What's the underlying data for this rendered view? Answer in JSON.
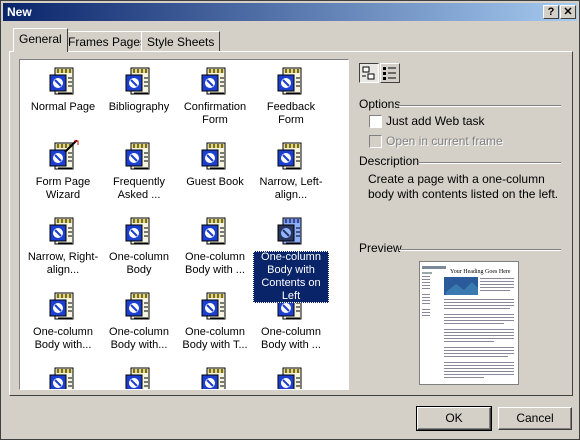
{
  "window": {
    "title": "New"
  },
  "title_buttons": {
    "help": "?",
    "close": "✕"
  },
  "tabs": [
    {
      "label": "General",
      "active": true
    },
    {
      "label": "Frames Pages",
      "active": false
    },
    {
      "label": "Style Sheets",
      "active": false
    }
  ],
  "templates": [
    {
      "label": "Normal Page",
      "icon": "page-template-icon"
    },
    {
      "label": "Bibliography",
      "icon": "page-template-icon"
    },
    {
      "label": "Confirmation Form",
      "icon": "page-template-icon"
    },
    {
      "label": "Feedback Form",
      "icon": "page-template-icon"
    },
    {
      "label": "Form Page Wizard",
      "icon": "wizard-template-icon"
    },
    {
      "label": "Frequently Asked ...",
      "icon": "page-template-icon"
    },
    {
      "label": "Guest Book",
      "icon": "page-template-icon"
    },
    {
      "label": "Narrow, Left-align...",
      "icon": "page-template-icon"
    },
    {
      "label": "Narrow, Right-align...",
      "icon": "page-template-icon"
    },
    {
      "label": "One-column Body",
      "icon": "page-template-icon"
    },
    {
      "label": "One-column Body with ...",
      "icon": "page-template-icon"
    },
    {
      "label": "One-column Body with Contents on Left",
      "icon": "page-template-icon",
      "selected": true
    },
    {
      "label": "One-column Body with...",
      "icon": "page-template-icon"
    },
    {
      "label": "One-column Body with...",
      "icon": "page-template-icon"
    },
    {
      "label": "One-column Body with T...",
      "icon": "page-template-icon"
    },
    {
      "label": "One-column Body with ...",
      "icon": "page-template-icon"
    },
    {
      "label": "",
      "icon": "page-template-icon"
    },
    {
      "label": "",
      "icon": "page-template-icon"
    },
    {
      "label": "",
      "icon": "page-template-icon"
    },
    {
      "label": "",
      "icon": "page-template-icon"
    }
  ],
  "view_buttons": {
    "large_icons": "large-icons-view-icon",
    "list": "list-view-icon"
  },
  "options": {
    "heading": "Options",
    "just_add_web_task": {
      "label": "Just add Web task",
      "checked": false,
      "enabled": true
    },
    "open_in_current_frame": {
      "label": "Open in current frame",
      "checked": false,
      "enabled": false
    }
  },
  "description": {
    "heading": "Description",
    "text": "Create a page with a one-column body with contents listed on the left."
  },
  "preview": {
    "heading": "Preview",
    "page_heading": "Your Heading Goes Here"
  },
  "buttons": {
    "ok": "OK",
    "cancel": "Cancel"
  },
  "colors": {
    "face": "#d4d0c8",
    "selection": "#0a246a",
    "title_start": "#0a246a",
    "title_end": "#a6caf0"
  }
}
